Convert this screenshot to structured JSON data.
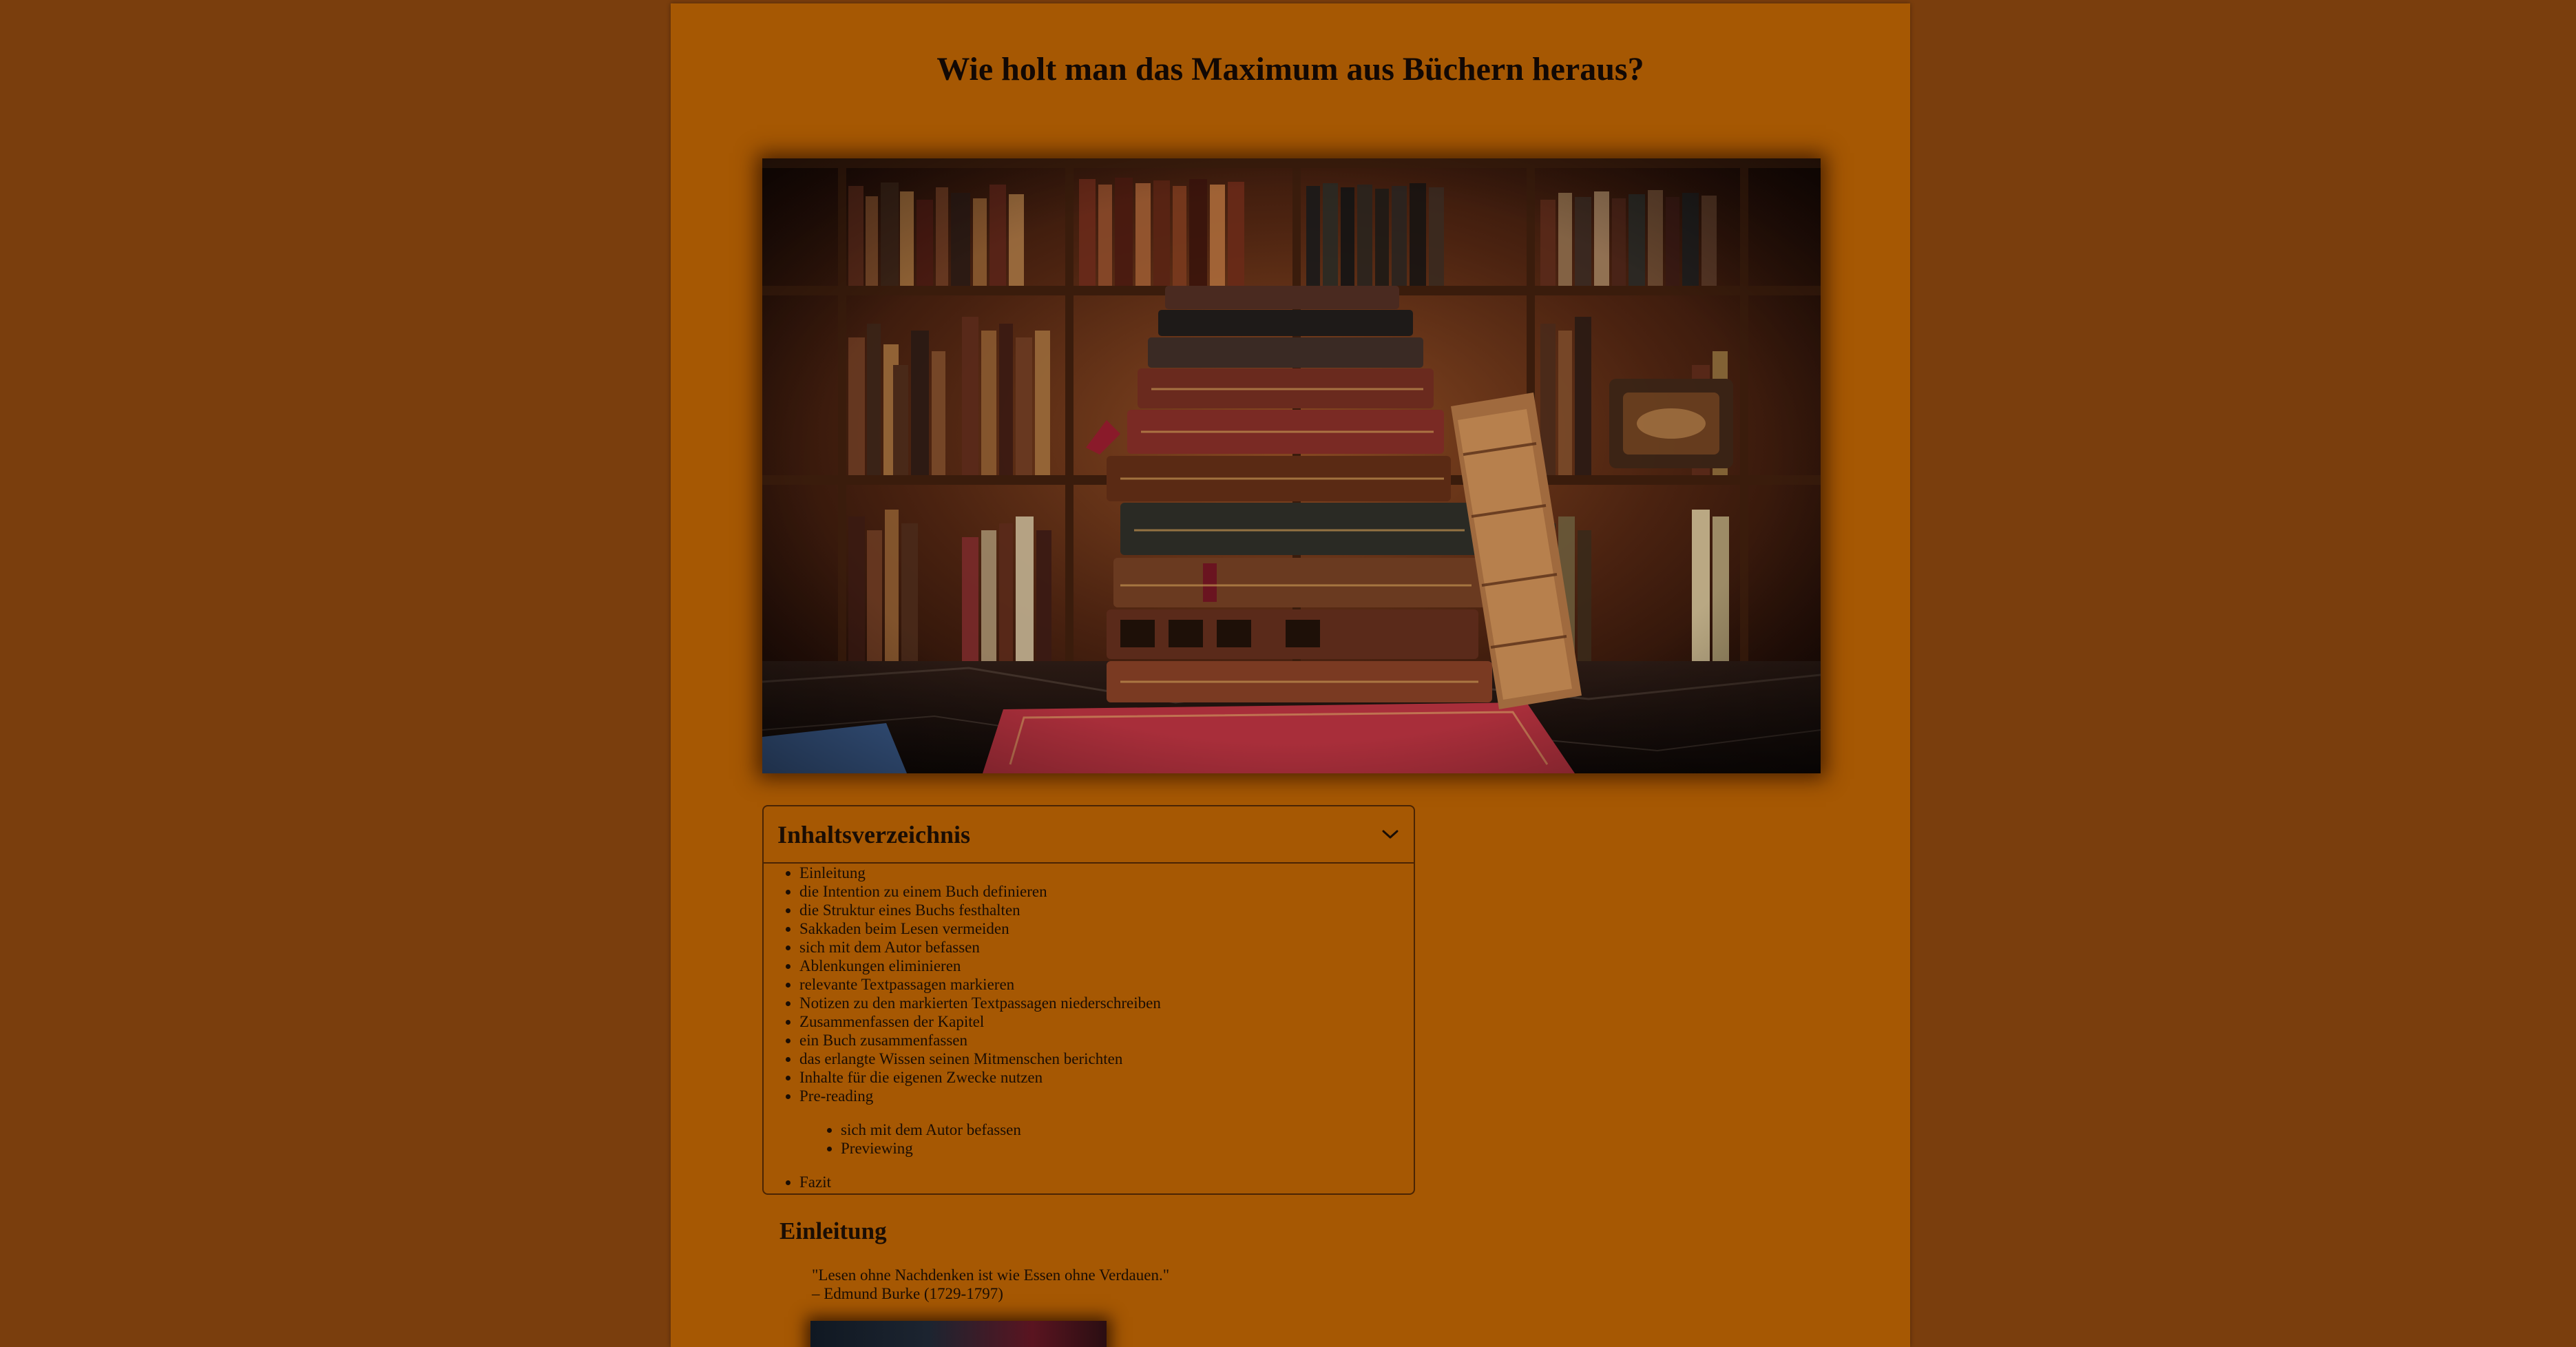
{
  "page": {
    "title": "Wie holt man das Maximum aus Büchern heraus?",
    "hero_image": "stacked-old-books-library-photo"
  },
  "toc": {
    "title": "Inhaltsverzeichnis",
    "toggle_icon": "chevron-down-icon",
    "items": [
      "Einleitung",
      "die Intention zu einem Buch definieren",
      "die Struktur eines Buchs festhalten",
      "Sakkaden beim Lesen vermeiden",
      "sich mit dem Autor befassen",
      "Ablenkungen eliminieren",
      "relevante Textpassagen markieren",
      "Notizen zu den markierten Textpassagen niederschreiben",
      "Zusammenfassen der Kapitel",
      "ein Buch zusammenfassen",
      "das erlangte Wissen seinen Mitmenschen berichten",
      "Inhalte für die eigenen Zwecke nutzen",
      "Pre-reading"
    ],
    "subitems": [
      "sich mit dem Autor befassen",
      "Previewing"
    ],
    "last_item": "Fazit"
  },
  "intro": {
    "heading": "Einleitung",
    "quote": "\"Lesen ohne Nachdenken ist wie Essen ohne Verdauen.\"",
    "author": "– Edmund Burke (1729-1797)"
  },
  "colors": {
    "background": "#7a3e0d",
    "page": "#a65803",
    "text": "#1a0d04",
    "border": "#4a2404"
  }
}
